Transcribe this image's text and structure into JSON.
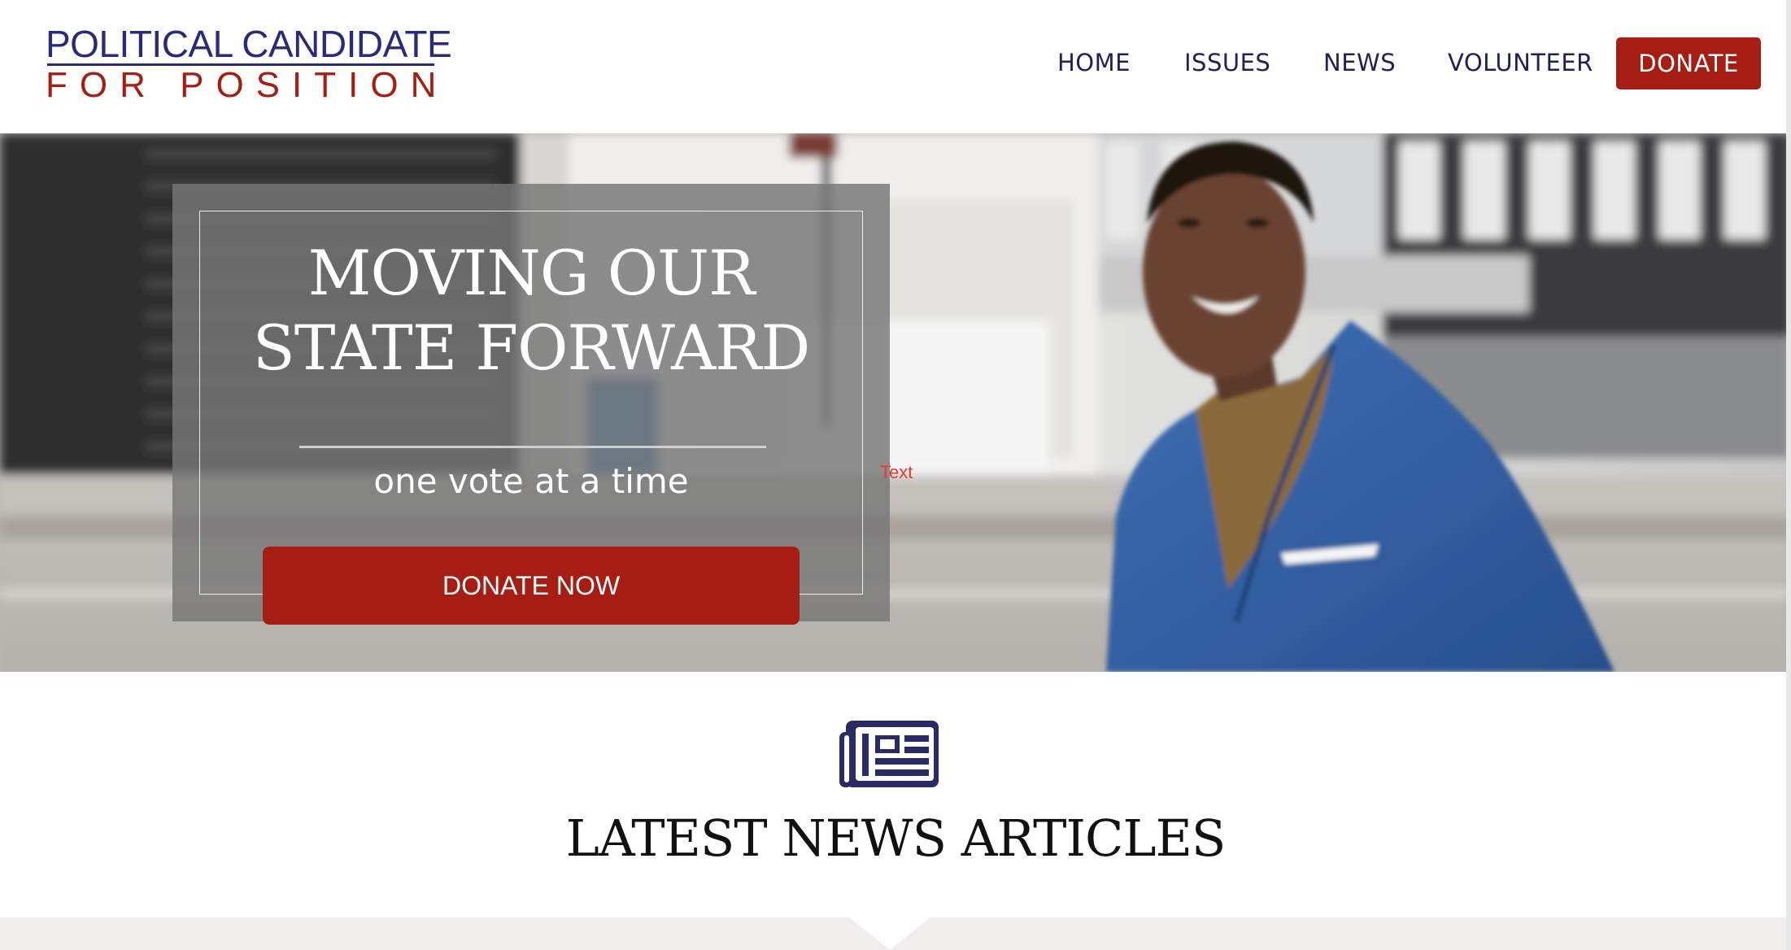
{
  "brand": {
    "line1": "POLITICAL CANDIDATE",
    "line2": "FOR POSITION",
    "colors": {
      "navy": "#2a2b78",
      "red": "#a51d13"
    }
  },
  "nav": {
    "items": [
      {
        "label": "HOME"
      },
      {
        "label": "ISSUES"
      },
      {
        "label": "NEWS"
      },
      {
        "label": "VOLUNTEER"
      }
    ],
    "donate_label": "DONATE"
  },
  "hero": {
    "title_line1": "MOVING OUR",
    "title_line2": "STATE FORWARD",
    "subtitle": "one vote at a time",
    "cta_label": "DONATE NOW",
    "stray_label": "Text"
  },
  "news": {
    "icon": "newspaper-icon",
    "heading": "LATEST NEWS ARTICLES"
  }
}
